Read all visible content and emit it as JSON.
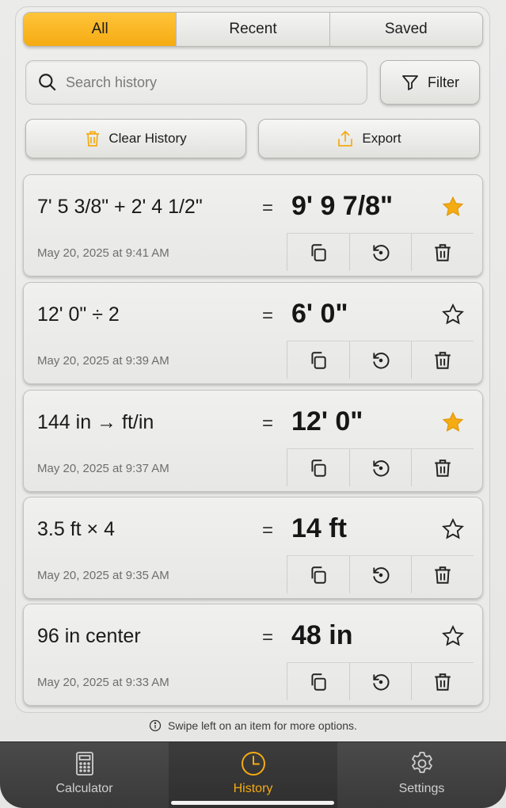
{
  "segments": [
    {
      "label": "All",
      "active": true
    },
    {
      "label": "Recent",
      "active": false
    },
    {
      "label": "Saved",
      "active": false
    }
  ],
  "search": {
    "placeholder": "Search history",
    "value": ""
  },
  "filter_label": "Filter",
  "clear_label": "Clear History",
  "export_label": "Export",
  "accent_color": "#f5ab12",
  "history": [
    {
      "expression": "7' 5 3/8\" + 2' 4 1/2\"",
      "equals": "=",
      "result": "9' 9 7/8\"",
      "timestamp": "May 20, 2025 at 9:41 AM",
      "starred": true
    },
    {
      "expression": "12' 0\" ÷ 2",
      "equals": "=",
      "result": "6' 0\"",
      "timestamp": "May 20, 2025 at 9:39 AM",
      "starred": false
    },
    {
      "expression": "144 in → ft/in",
      "equals": "=",
      "result": "12' 0\"",
      "timestamp": "May 20, 2025 at 9:37 AM",
      "starred": true
    },
    {
      "expression": "3.5 ft × 4",
      "equals": "=",
      "result": "14 ft",
      "timestamp": "May 20, 2025 at 9:35 AM",
      "starred": false
    },
    {
      "expression": "96 in center",
      "equals": "=",
      "result": "48 in",
      "timestamp": "May 20, 2025 at 9:33 AM",
      "starred": false
    }
  ],
  "hint": "Swipe left on an item for more options.",
  "tabs": [
    {
      "label": "Calculator",
      "icon": "calculator-icon",
      "active": false
    },
    {
      "label": "History",
      "icon": "clock-icon",
      "active": true
    },
    {
      "label": "Settings",
      "icon": "gear-icon",
      "active": false
    }
  ]
}
